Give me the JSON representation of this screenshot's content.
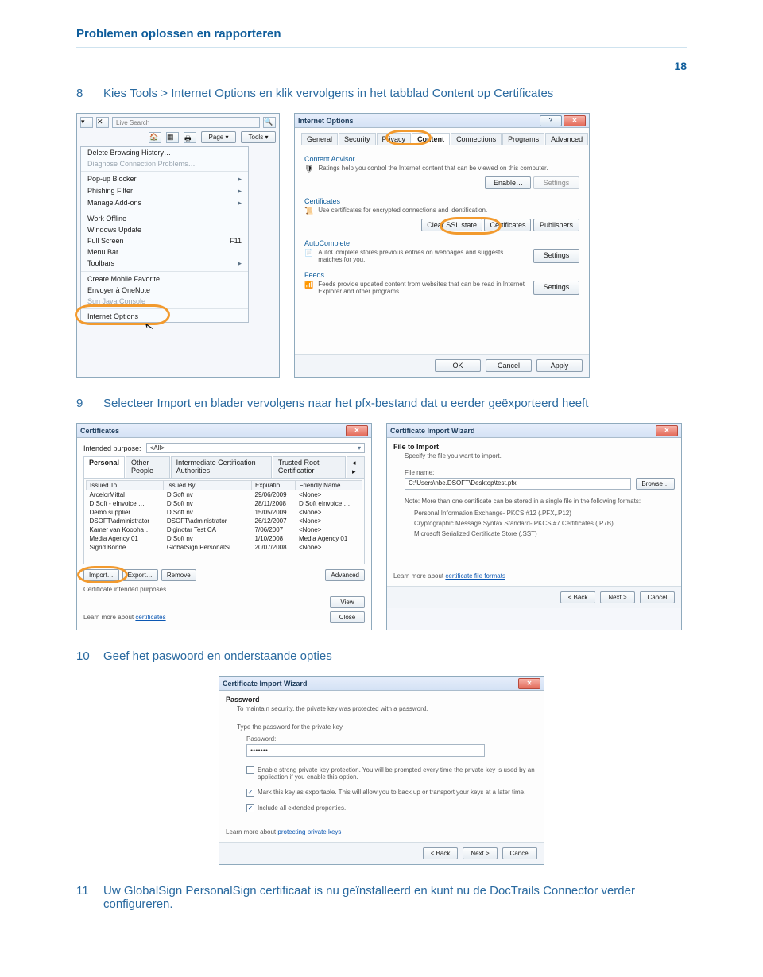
{
  "doc": {
    "header": "Problemen oplossen en rapporteren",
    "page_no": "18"
  },
  "steps": {
    "s8": {
      "n": "8",
      "t": "Kies Tools > Internet Options en klik vervolgens in het tabblad Content op Certificates"
    },
    "s9": {
      "n": "9",
      "t": "Selecteer Import en blader vervolgens naar het pfx-bestand dat u eerder geëxporteerd heeft"
    },
    "s10": {
      "n": "10",
      "t": "Geef het paswoord en onderstaande opties"
    },
    "s11": {
      "n": "11",
      "t": "Uw GlobalSign PersonalSign certificaat is nu geïnstalleerd en kunt nu de DocTrails Connector verder configureren."
    }
  },
  "browser": {
    "search_placeholder": "Live Search",
    "toolbar": {
      "page": "Page",
      "tools": "Tools"
    },
    "menu": [
      "Delete Browsing History…",
      "Diagnose Connection Problems…",
      "Pop-up Blocker",
      "Phishing Filter",
      "Manage Add-ons",
      "Work Offline",
      "Windows Update",
      "Full Screen",
      "Menu Bar",
      "Toolbars",
      "Create Mobile Favorite…",
      "Envoyer à OneNote",
      "Sun Java Console",
      "Internet Options"
    ],
    "shortcut_fullscreen": "F11"
  },
  "ioptions": {
    "title": "Internet Options",
    "tabs": [
      "General",
      "Security",
      "Privacy",
      "Content",
      "Connections",
      "Programs",
      "Advanced"
    ],
    "contentAdvisor": {
      "label": "Content Advisor",
      "desc": "Ratings help you control the Internet content that can be viewed on this computer.",
      "enable": "Enable…",
      "settings": "Settings"
    },
    "certs": {
      "label": "Certificates",
      "desc": "Use certificates for encrypted connections and identification.",
      "clear": "Clear SSL state",
      "certificates": "Certificates",
      "publishers": "Publishers"
    },
    "auto": {
      "label": "AutoComplete",
      "desc": "AutoComplete stores previous entries on webpages and suggests matches for you.",
      "settings": "Settings"
    },
    "feeds": {
      "label": "Feeds",
      "desc": "Feeds provide updated content from websites that can be read in Internet Explorer and other programs.",
      "settings": "Settings"
    },
    "ok": "OK",
    "cancel": "Cancel",
    "apply": "Apply"
  },
  "certdlg": {
    "title": "Certificates",
    "intended_label": "Intended purpose:",
    "intended_value": "<All>",
    "tabs": [
      "Personal",
      "Other People",
      "Intermediate Certification Authorities",
      "Trusted Root Certificatior"
    ],
    "cols": [
      "Issued To",
      "Issued By",
      "Expiratio…",
      "Friendly Name"
    ],
    "rows": [
      [
        "ArcelorMittal",
        "D Soft nv",
        "29/06/2009",
        "<None>"
      ],
      [
        "D Soft - eInvoice …",
        "D Soft nv",
        "28/11/2008",
        "D Soft eInvoice …"
      ],
      [
        "Demo supplier",
        "D Soft nv",
        "15/05/2009",
        "<None>"
      ],
      [
        "DSOFT\\administrator",
        "DSOFT\\administrator",
        "26/12/2007",
        "<None>"
      ],
      [
        "Kamer van Koopha…",
        "Diginotar Test CA",
        "7/06/2007",
        "<None>"
      ],
      [
        "Media Agency 01",
        "D Soft nv",
        "1/10/2008",
        "Media Agency 01"
      ],
      [
        "Sigrid Bonne",
        "GlobalSign PersonalSi…",
        "20/07/2008",
        "<None>"
      ]
    ],
    "import": "Import…",
    "export": "Export…",
    "remove": "Remove",
    "advanced": "Advanced",
    "purposes_label": "Certificate intended purposes",
    "view": "View",
    "learn": "Learn more about ",
    "learn_link": "certificates",
    "close": "Close"
  },
  "wiz_file": {
    "title": "Certificate Import Wizard",
    "heading": "File to Import",
    "sub": "Specify the file you want to import.",
    "fname_label": "File name:",
    "fname_value": "C:\\Users\\nbe.DSOFT\\Desktop\\test.pfx",
    "browse": "Browse…",
    "note": "Note:  More than one certificate can be stored in a single file in the following formats:",
    "fmt1": "Personal Information Exchange- PKCS #12 (.PFX,.P12)",
    "fmt2": "Cryptographic Message Syntax Standard- PKCS #7 Certificates (.P7B)",
    "fmt3": "Microsoft Serialized Certificate Store (.SST)",
    "learn": "Learn more about ",
    "learn_link": "certificate file formats",
    "back": "< Back",
    "next": "Next >",
    "cancel": "Cancel"
  },
  "wiz_pw": {
    "title": "Certificate Import Wizard",
    "heading": "Password",
    "sub": "To maintain security, the private key was protected with a password.",
    "type_label": "Type the password for the private key.",
    "pw_label": "Password:",
    "pw_value": "•••••••",
    "opt1": "Enable strong private key protection. You will be prompted every time the private key is used by an application if you enable this option.",
    "opt2": "Mark this key as exportable. This will allow you to back up or transport your keys at a later time.",
    "opt3": "Include all extended properties.",
    "learn": "Learn more about ",
    "learn_link": "protecting private keys",
    "back": "< Back",
    "next": "Next >",
    "cancel": "Cancel"
  }
}
